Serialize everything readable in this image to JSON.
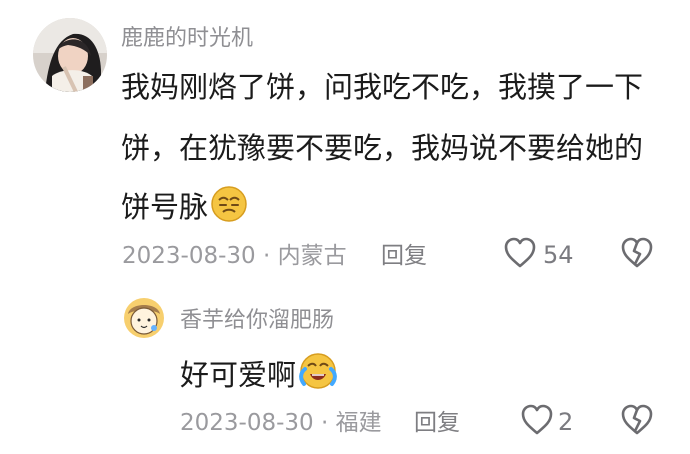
{
  "main_comment": {
    "username": "鹿鹿的时光机",
    "line1": "我妈刚烙了饼，问我吃不吃，我摸了一下",
    "line2": "饼，在犹豫要不要吃，我妈说不要给她的",
    "line3": "饼号脉",
    "date_location": "2023-08-30 · 内蒙古",
    "reply_label": "回复",
    "like_count": "54",
    "emoji": "smirk-face-emoji"
  },
  "reply_comment": {
    "username": "香芋给你溜肥肠",
    "text": "好可爱啊",
    "date_location": "2023-08-30 · 福建",
    "reply_label": "回复",
    "like_count": "2",
    "emoji": "crying-laughing-face-emoji"
  },
  "icons": {
    "like": "heart-outline-icon",
    "dislike": "broken-heart-icon"
  },
  "colors": {
    "username": "#8f8f93",
    "meta": "#9a9a9e",
    "body_text": "#1b1b1b",
    "icon_gray": "#666666",
    "emoji_yellow": "#f5c542"
  }
}
